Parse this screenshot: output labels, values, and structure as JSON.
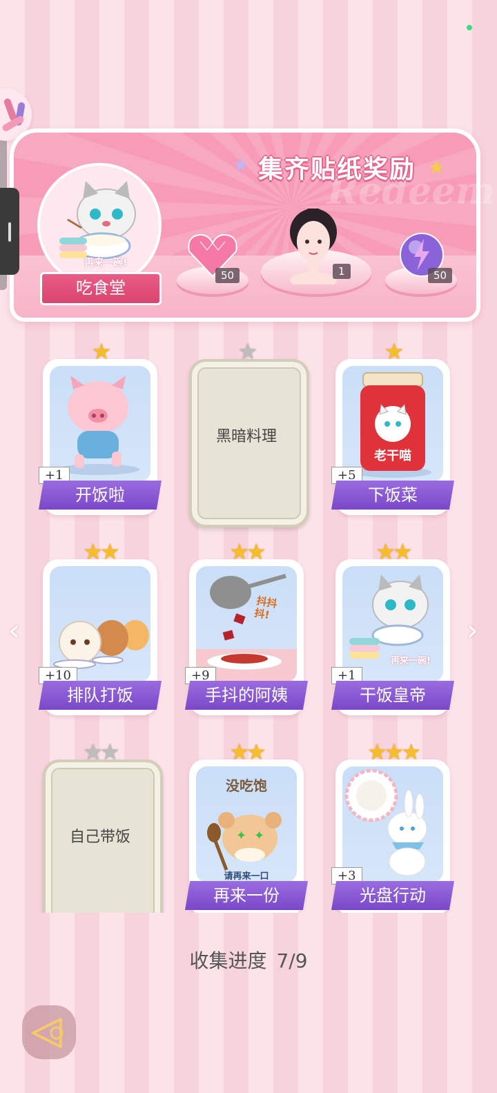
{
  "banner": {
    "title": "集齐贴纸奖励",
    "watermark": "Redeem",
    "canteen_label": "吃食堂",
    "canteen_sticker_text": "再来一碗!",
    "rewards": [
      {
        "icon": "pink-heart-gem-icon",
        "count": "50"
      },
      {
        "icon": "character-portrait",
        "count": "1"
      },
      {
        "icon": "lightning-orb-icon",
        "count": "50"
      }
    ]
  },
  "cards": [
    {
      "label": "开饭啦",
      "stars": 1,
      "collected": true,
      "count": "+1",
      "art": "running-pig"
    },
    {
      "label": "黑暗料理",
      "stars": 1,
      "collected": false,
      "count": "",
      "art": ""
    },
    {
      "label": "下饭菜",
      "stars": 1,
      "collected": true,
      "count": "+5",
      "art": "chili-jar",
      "art_text": "老干喵"
    },
    {
      "label": "排队打饭",
      "stars": 2,
      "collected": true,
      "count": "+10",
      "art": "cats-queue"
    },
    {
      "label": "手抖的阿姨",
      "stars": 2,
      "collected": true,
      "count": "+9",
      "art": "ladle-serving",
      "art_text": "抖抖抖!"
    },
    {
      "label": "干饭皇帝",
      "stars": 2,
      "collected": true,
      "count": "+1",
      "art": "cat-eating",
      "art_text": "再来一碗!"
    },
    {
      "label": "自己带饭",
      "stars": 2,
      "collected": false,
      "count": "",
      "art": ""
    },
    {
      "label": "再来一份",
      "stars": 2,
      "collected": true,
      "count": "",
      "art": "hamster-spoon",
      "art_text": "没吃饱",
      "art_text2": "请再来一口"
    },
    {
      "label": "光盘行动",
      "stars": 3,
      "collected": true,
      "count": "+3",
      "art": "bunny-plate"
    }
  ],
  "progress": {
    "label": "收集进度",
    "value": "7/9"
  },
  "colors": {
    "accent": "#7a48c8",
    "banner": "#f79bb6",
    "star": "#f5bd2b"
  }
}
